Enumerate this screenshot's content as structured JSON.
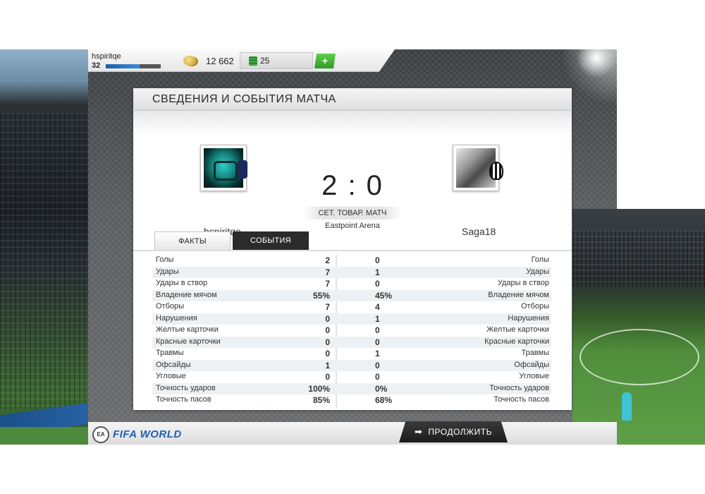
{
  "topbar": {
    "username": "hspiritqe",
    "level": "32",
    "xp_fraction": 0.62,
    "coins": "12 662",
    "points": "25",
    "add_label": "+"
  },
  "panel": {
    "title": "СВЕДЕНИЯ И СОБЫТИЯ МАТЧА",
    "home_player": "hspiritqe",
    "away_player": "Saga18",
    "score": "2 : 0",
    "match_type": "СЕТ. ТОВАР. МАТЧ",
    "venue": "Eastpoint Arena",
    "tabs": [
      {
        "label": "ФАКТЫ",
        "active": true
      },
      {
        "label": "СОБЫТИЯ",
        "active": false
      }
    ]
  },
  "stats": [
    {
      "label": "Голы",
      "home": "2",
      "away": "0"
    },
    {
      "label": "Удары",
      "home": "7",
      "away": "1"
    },
    {
      "label": "Удары в створ",
      "home": "7",
      "away": "0"
    },
    {
      "label": "Владение мячом",
      "home": "55%",
      "away": "45%"
    },
    {
      "label": "Отборы",
      "home": "7",
      "away": "4"
    },
    {
      "label": "Нарушения",
      "home": "0",
      "away": "1"
    },
    {
      "label": "Желтые карточки",
      "home": "0",
      "away": "0"
    },
    {
      "label": "Красные карточки",
      "home": "0",
      "away": "0"
    },
    {
      "label": "Травмы",
      "home": "0",
      "away": "1"
    },
    {
      "label": "Офсайды",
      "home": "1",
      "away": "0"
    },
    {
      "label": "Угловые",
      "home": "0",
      "away": "0"
    },
    {
      "label": "Точность ударов",
      "home": "100%",
      "away": "0%"
    },
    {
      "label": "Точность пасов",
      "home": "85%",
      "away": "68%"
    }
  ],
  "bottombar": {
    "ea_logo": "EA SPORTS",
    "fifa_logo": "FIFA WORLD",
    "continue_label": "ПРОДОЛЖИТЬ"
  },
  "colors": {
    "accent_blue": "#1c5fa8",
    "plus_green": "#2e9a22",
    "dark_tab": "#2b2b2b"
  },
  "icons": {
    "coins": "coin-icon",
    "points": "points-icon",
    "continue": "arrow-right-icon"
  }
}
